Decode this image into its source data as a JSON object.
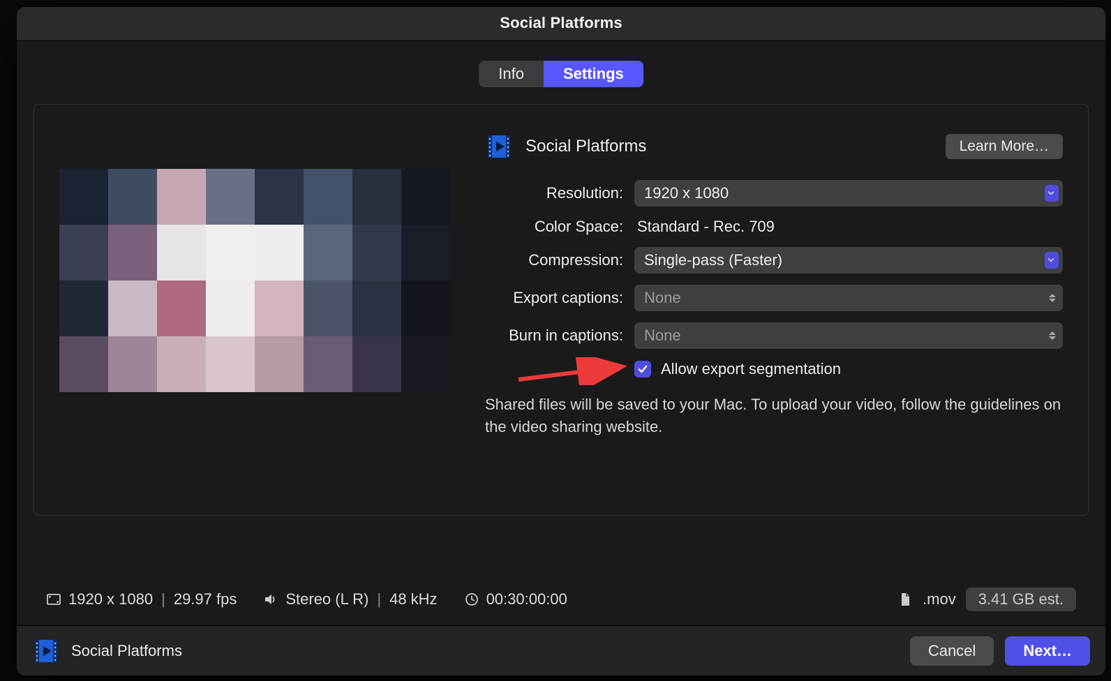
{
  "header": {
    "title": "Social Platforms"
  },
  "tabs": {
    "info": "Info",
    "settings": "Settings",
    "active": "settings"
  },
  "destination": {
    "name": "Social Platforms",
    "learn_more": "Learn More…"
  },
  "settings": {
    "resolution_label": "Resolution:",
    "resolution_value": "1920 x 1080",
    "colorspace_label": "Color Space:",
    "colorspace_value": "Standard - Rec. 709",
    "compression_label": "Compression:",
    "compression_value": "Single-pass (Faster)",
    "export_captions_label": "Export captions:",
    "export_captions_value": "None",
    "burnin_captions_label": "Burn in captions:",
    "burnin_captions_value": "None",
    "allow_seg_label": "Allow export segmentation",
    "allow_seg_checked": true,
    "help_text": "Shared files will be saved to your Mac. To upload your video, follow the guidelines on the video sharing website."
  },
  "stats": {
    "dimensions": "1920 x 1080",
    "fps": "29.97 fps",
    "audio": "Stereo (L R)",
    "sample_rate": "48 kHz",
    "duration": "00:30:00:00",
    "extension": ".mov",
    "size_est": "3.41 GB est."
  },
  "footer": {
    "destination_name": "Social Platforms",
    "cancel": "Cancel",
    "next": "Next…"
  },
  "colors": {
    "accent": "#5150e6",
    "arrow": "#ed3a3a"
  }
}
